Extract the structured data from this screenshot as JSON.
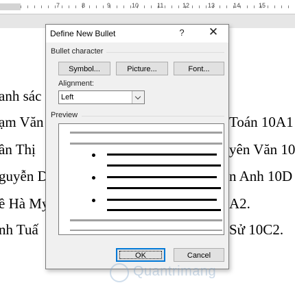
{
  "ruler": {
    "numbers": [
      "7",
      "8",
      "9",
      "10",
      "11",
      "12",
      "13",
      "14",
      "15"
    ]
  },
  "document": {
    "lines": [
      {
        "left": "anh sác",
        "right": ""
      },
      {
        "left": "ạm Văn",
        "right": "Toán 10A1"
      },
      {
        "left": "ần Thị",
        "right": "yên Văn 10"
      },
      {
        "left": "guyễn D",
        "right": "n Anh 10D"
      },
      {
        "left": "ề Hà My",
        "right": "A2."
      },
      {
        "left": "nh Tuấ",
        "right": "Sử 10C2."
      }
    ]
  },
  "dialog": {
    "title": "Define New Bullet",
    "help_label": "?",
    "close_label": "✕",
    "bullet_character_label": "Bullet character",
    "symbol_button": "Symbol...",
    "picture_button": "Picture...",
    "font_button": "Font...",
    "alignment_label": "Alignment:",
    "alignment_value": "Left",
    "preview_label": "Preview",
    "ok_button": "OK",
    "cancel_button": "Cancel"
  },
  "watermark": {
    "text": "Quantrimang"
  },
  "colors": {
    "accent": "#0078d7",
    "dialog_bg": "#f0f0f0"
  }
}
